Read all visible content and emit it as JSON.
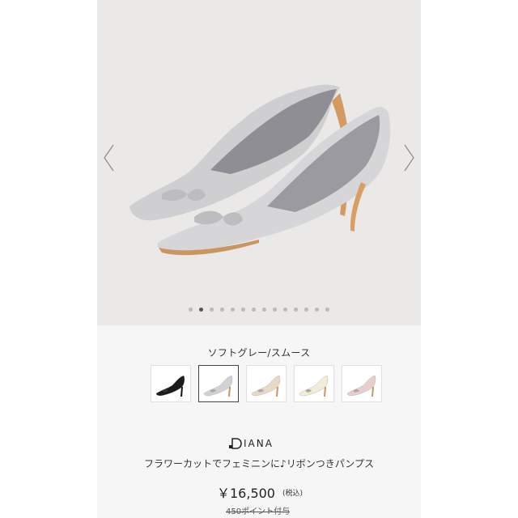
{
  "gallery": {
    "prev_icon": "chevron-left-icon",
    "next_icon": "chevron-right-icon",
    "dot_count": 14,
    "active_dot": 1,
    "background": "#eae9e8"
  },
  "product": {
    "color_label": "ソフトグレー/スムース",
    "swatches": [
      {
        "name": "black",
        "color": "#1b1b1b"
      },
      {
        "name": "soft-grey",
        "color": "#d2d2d4"
      },
      {
        "name": "beige",
        "color": "#e8d9c6"
      },
      {
        "name": "ivory",
        "color": "#f3ecd6"
      },
      {
        "name": "pink",
        "color": "#e8cfcd"
      }
    ],
    "selected_swatch": 1,
    "brand": "IANA",
    "name": "フラワーカットでフェミニンに♪リボンつきパンプス",
    "price": "￥16,500",
    "tax_note": "(税込)",
    "points_note": "450ポイント付与"
  }
}
